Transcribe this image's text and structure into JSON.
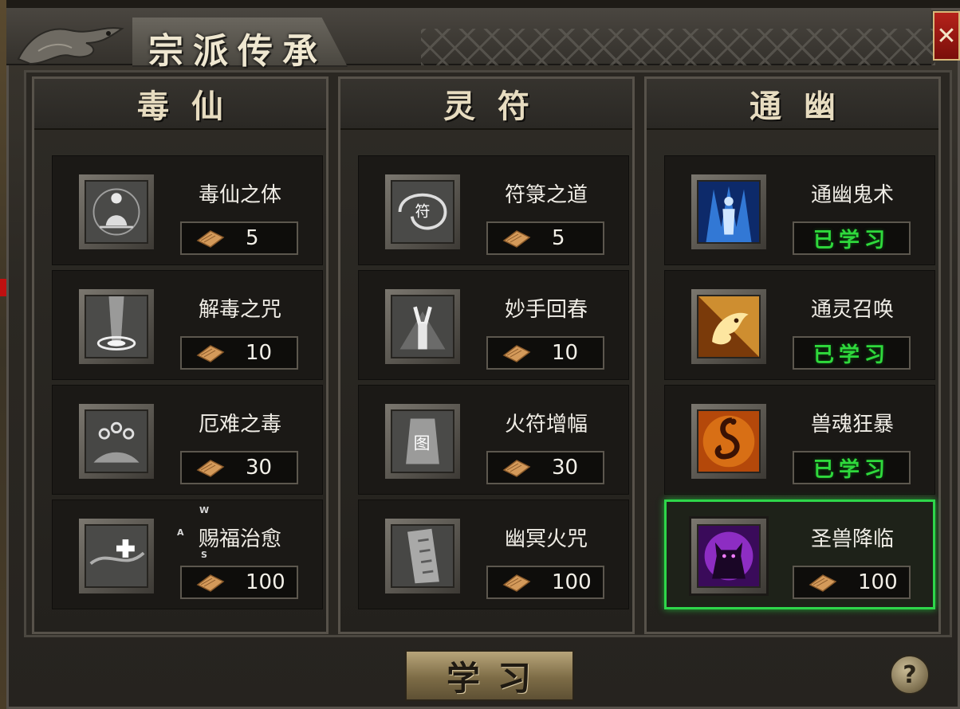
{
  "window": {
    "title": "宗派传承",
    "close_label": "✕"
  },
  "columns": [
    {
      "title": "毒仙",
      "skills": [
        {
          "name": "毒仙之体",
          "cost": "5",
          "learned": false,
          "icon": "meditating-figure-icon"
        },
        {
          "name": "解毒之咒",
          "cost": "10",
          "learned": false,
          "icon": "light-pillar-icon"
        },
        {
          "name": "厄难之毒",
          "cost": "30",
          "learned": false,
          "icon": "poison-flames-icon"
        },
        {
          "name": "赐福治愈",
          "cost": "100",
          "learned": false,
          "icon": "healing-cross-icon"
        }
      ]
    },
    {
      "title": "灵符",
      "skills": [
        {
          "name": "符箓之道",
          "cost": "5",
          "learned": false,
          "icon": "talisman-swirl-icon"
        },
        {
          "name": "妙手回春",
          "cost": "10",
          "learned": false,
          "icon": "raised-hands-icon"
        },
        {
          "name": "火符增幅",
          "cost": "30",
          "learned": false,
          "icon": "fire-talisman-icon"
        },
        {
          "name": "幽冥火咒",
          "cost": "100",
          "learned": false,
          "icon": "scroll-charm-icon"
        }
      ]
    },
    {
      "title": "通幽",
      "skills": [
        {
          "name": "通幽鬼术",
          "cost": "",
          "learned": true,
          "icon": "ghost-aura-icon"
        },
        {
          "name": "通灵召唤",
          "cost": "",
          "learned": true,
          "icon": "fire-beast-icon"
        },
        {
          "name": "兽魂狂暴",
          "cost": "",
          "learned": true,
          "icon": "fire-serpent-icon"
        },
        {
          "name": "圣兽降临",
          "cost": "100",
          "learned": false,
          "selected": true,
          "icon": "demon-beast-icon"
        }
      ]
    }
  ],
  "learned_label": "已学习",
  "cost_icon": "scroll-currency-icon",
  "overlay_keys": {
    "w": "W",
    "a": "A",
    "s": "S"
  },
  "buttons": {
    "learn": "学习",
    "help": "?"
  },
  "colors": {
    "learned_text": "#2fd93c",
    "selected_border": "#2ed64a",
    "close_button": "#b5221b"
  }
}
